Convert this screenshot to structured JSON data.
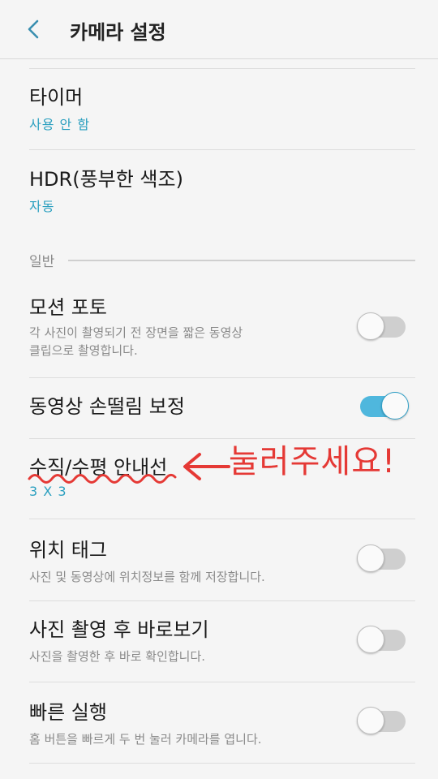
{
  "header": {
    "title": "카메라 설정",
    "back_icon": "chevron-left-icon"
  },
  "items": [
    {
      "title": "타이머",
      "value": "사용 안 함"
    },
    {
      "title": "HDR(풍부한 색조)",
      "value": "자동"
    }
  ],
  "section": {
    "label": "일반"
  },
  "general_items": [
    {
      "title": "모션 포토",
      "desc_lines": [
        "각 사진이 촬영되기 전 장면을 짧은 동영상",
        "클립으로 촬영합니다."
      ],
      "toggle_on": false
    },
    {
      "title": "동영상 손떨림 보정",
      "toggle_on": true
    },
    {
      "title": "수직/수평 안내선",
      "value": "3 X 3"
    },
    {
      "title": "위치 태그",
      "desc": "사진 및 동영상에 위치정보를 함께 저장합니다.",
      "toggle_on": false
    },
    {
      "title": "사진 촬영 후 바로보기",
      "desc": "사진을 촬영한 후 바로 확인합니다.",
      "toggle_on": false
    },
    {
      "title": "빠른 실행",
      "desc": "홈 버튼을 빠르게 두 번 눌러 카메라를 엽니다.",
      "toggle_on": false
    }
  ],
  "annotation": {
    "text": "눌러주세요!",
    "color": "#e53935"
  },
  "colors": {
    "accent": "#2a9fbf",
    "toggle_on": "#4fb7dd",
    "annotation": "#e53935"
  }
}
